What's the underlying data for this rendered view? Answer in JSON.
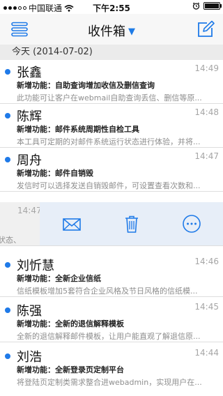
{
  "status_bar": {
    "carrier": "中国联通",
    "time": "下午2:55"
  },
  "nav": {
    "title": "收件箱",
    "menu_icon": "menu-icon",
    "compose_icon": "compose-icon",
    "title_caret": "dropdown-caret-icon"
  },
  "section": {
    "label": "今天 (2014-07-02)"
  },
  "emails": [
    {
      "sender": "张鑫",
      "time": "14:49",
      "subject": "新增功能：自助查询增加收信及删信查询",
      "preview": "此功能可让客户在webmail自助查询丢信、删信等原...",
      "unread": true
    },
    {
      "sender": "陈辉",
      "time": "14:48",
      "subject": "新增功能：邮件系统周期性自检工具",
      "preview": "本工具可定期的对邮件系统运行状态进行体验，并将...",
      "unread": true
    },
    {
      "sender": "周舟",
      "time": "14:47",
      "subject": "新增功能：邮件自销毁",
      "preview": "发信时可以选择发送自销毁邮件，可设置查看次数和...",
      "unread": true
    },
    {
      "sender": "",
      "time": "14:47",
      "subject": "",
      "preview": "信状态、",
      "unread": false,
      "swiped": true
    },
    {
      "sender": "刘忻慧",
      "time": "14:46",
      "subject": "新增功能：全新企业信纸",
      "preview": "信纸模板增加5套符合企业风格及节日风格的信纸模...",
      "unread": true
    },
    {
      "sender": "陈强",
      "time": "14:45",
      "subject": "新增功能：全新的退信解释模板",
      "preview": "全新的退信解释邮件模板，让用户能直观了解退信原...",
      "unread": true
    },
    {
      "sender": "刘浩",
      "time": "14:44",
      "subject": "新增功能：全新登录页定制平台",
      "preview": "将登陆页定制类需求整合进webadmin，实现用户在...",
      "unread": true
    }
  ],
  "swipe_actions": [
    "mark-envelope-icon",
    "trash-icon",
    "more-icon"
  ],
  "colors": {
    "accent": "#1f7ae8",
    "nav_bg": "#f7f7f7",
    "section_bg": "#ebebeb",
    "swipe_bg": "#e7eef8"
  }
}
